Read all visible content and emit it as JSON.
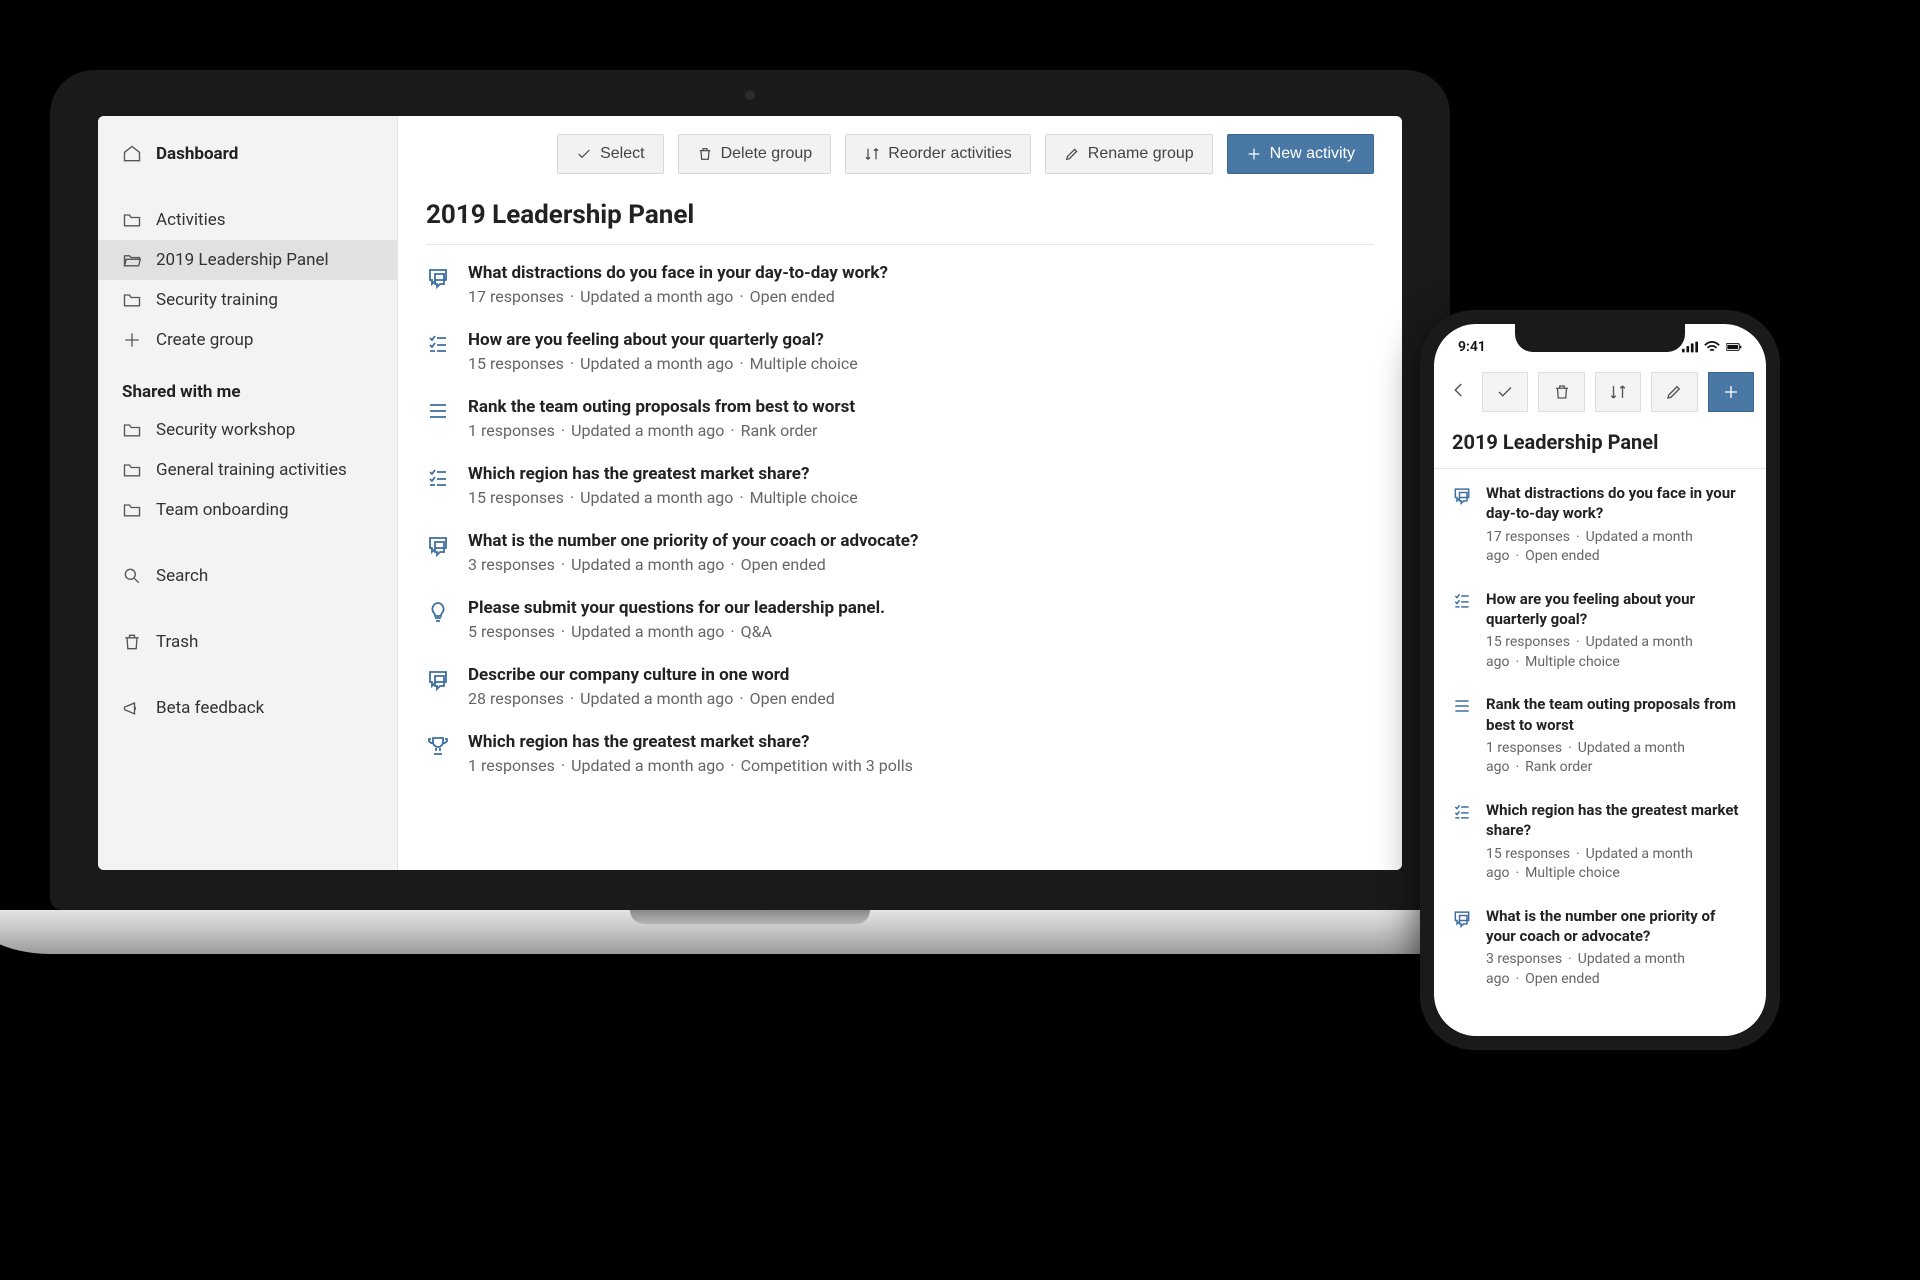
{
  "sidebar": {
    "dashboard": "Dashboard",
    "groups": [
      {
        "label": "Activities",
        "icon": "folder",
        "selected": false
      },
      {
        "label": "2019 Leadership Panel",
        "icon": "folder-open",
        "selected": true
      },
      {
        "label": "Security training",
        "icon": "folder",
        "selected": false
      },
      {
        "label": "Create group",
        "icon": "plus",
        "selected": false
      }
    ],
    "shared_label": "Shared with me",
    "shared": [
      {
        "label": "Security workshop",
        "icon": "folder"
      },
      {
        "label": "General training activities",
        "icon": "folder"
      },
      {
        "label": "Team onboarding",
        "icon": "folder"
      }
    ],
    "search": "Search",
    "trash": "Trash",
    "beta": "Beta feedback"
  },
  "toolbar": {
    "select": "Select",
    "delete": "Delete group",
    "reorder": "Reorder activities",
    "rename": "Rename group",
    "new": "New activity"
  },
  "page_title": "2019 Leadership Panel",
  "activities": [
    {
      "icon": "chat",
      "title": "What distractions do you face in your day-to-day work?",
      "responses": "17 responses",
      "updated": "Updated a month ago",
      "type": "Open ended"
    },
    {
      "icon": "mc",
      "title": "How are you feeling about your quarterly goal?",
      "responses": "15 responses",
      "updated": "Updated a month ago",
      "type": "Multiple choice"
    },
    {
      "icon": "rank",
      "title": "Rank the team outing proposals from best to worst",
      "responses": "1 responses",
      "updated": "Updated a month ago",
      "type": "Rank order"
    },
    {
      "icon": "mc",
      "title": "Which region has the greatest market share?",
      "responses": "15 responses",
      "updated": "Updated a month ago",
      "type": "Multiple choice"
    },
    {
      "icon": "chat",
      "title": "What is the number one priority of your coach or advocate?",
      "responses": "3 responses",
      "updated": "Updated a month ago",
      "type": "Open ended"
    },
    {
      "icon": "bulb",
      "title": "Please submit your questions for our leadership panel.",
      "responses": "5 responses",
      "updated": "Updated a month ago",
      "type": "Q&A"
    },
    {
      "icon": "chat",
      "title": "Describe our company culture in one word",
      "responses": "28 responses",
      "updated": "Updated a month ago",
      "type": "Open ended"
    },
    {
      "icon": "trophy",
      "title": "Which region has the greatest market share?",
      "responses": "1 responses",
      "updated": "Updated a month ago",
      "type": "Competition with 3 polls"
    }
  ],
  "phone": {
    "time": "9:41",
    "title": "2019 Leadership Panel",
    "activities_idx": [
      0,
      1,
      2,
      3,
      4
    ]
  }
}
